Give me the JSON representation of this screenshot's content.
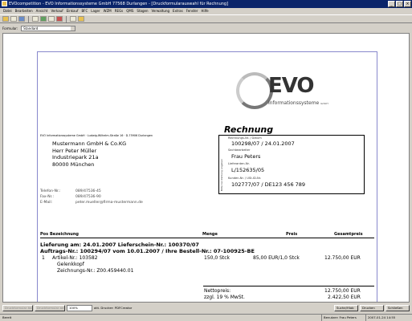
{
  "window": {
    "title": "EVOcompetition - EVO Informationssysteme GmbH 77568 Durlangen - [Druckformularauswahl für Rechnung]"
  },
  "menu": [
    "Datei",
    "Bearbeiten",
    "Ansicht",
    "Verkauf",
    "Einkauf",
    "BFC",
    "Lager",
    "WZM",
    "REGs",
    "QMS",
    "Stagen",
    "Verwaltung",
    "Extras",
    "Fenster",
    "Hilfe"
  ],
  "formbar": {
    "label": "Formular:",
    "value": "Standard"
  },
  "logo": {
    "mark": "EVO",
    "subtitle": "Informationssysteme",
    "suffix": "GmbH"
  },
  "sender_line": "EVO Informationssysteme GmbH · Ludwig-Wilhelm-Straße 16 · D-75906 Durlangen",
  "recipient": [
    "Mustermann GmbH & Co.KG",
    "Herr Peter Müller",
    "Industriepark 21a",
    "80000 München"
  ],
  "contact": [
    {
      "label": "Telefon-Nr.:",
      "value": "089/47536-45"
    },
    {
      "label": "Fax-Nr.:",
      "value": "089/47536-90"
    },
    {
      "label": "E-Mail:",
      "value": "peter.mueller@firma-mustermann.de"
    }
  ],
  "invoice": {
    "title": "Rechnung",
    "side_text": "Bitte bei Zahlung angeben",
    "fields": [
      {
        "label": "Rechnungs-Nr. / Datum",
        "value": "100298/07 / 24.01.2007"
      },
      {
        "label": "Sachbearbeiter",
        "value": "Frau Peters"
      },
      {
        "label": "Lieferanten-Nr.",
        "value": "L/152635/05"
      },
      {
        "label": "Kunden-Nr. / USt-ID-Nr.",
        "value": "102777/07 / DE123 456 789"
      }
    ]
  },
  "table": {
    "headers": {
      "pos": "Pos",
      "bez": "Bezeichnung",
      "menge": "Menge",
      "preis": "Preis",
      "gesamt": "Gesamtpreis"
    },
    "lieferung": "Lieferung am: 24.01.2007 Lieferschein-Nr.: 100370/07",
    "auftrag": "Auftrags-Nr.: 100294/07 vom 10.01.2007 / Ihre Bestell-Nr.: 07-100925-BE",
    "item": {
      "pos": "1",
      "lines": [
        "Artikel-Nr.: 103582",
        "Gelenkkopf",
        "Zeichnungs-Nr.: Z00.459440.01"
      ],
      "menge": "150,0 Stck",
      "preis": "85,00 EUR/1,0 Stck",
      "gesamt": "12.750,00 EUR"
    },
    "netto_label": "Nettopreis:",
    "netto_value": "12.750,00 EUR",
    "mwst_label": "zzgl. 19 % MwSt.",
    "mwst_value": "2.422,50 EUR"
  },
  "bottom": {
    "btn1": "Druckformular ändern",
    "btn2": "Druckformular ansehen",
    "zoom": "100%",
    "printer_label": "akt. Drucker: PDFCreator",
    "btn_suchen": "Suche/Hiob",
    "btn_drucken": "Drucken",
    "btn_schliessen": "Schließen"
  },
  "status": {
    "left": "Bereit",
    "user": "Benutzer: Frau Peters",
    "datetime": "2007-01-24 14:55"
  }
}
